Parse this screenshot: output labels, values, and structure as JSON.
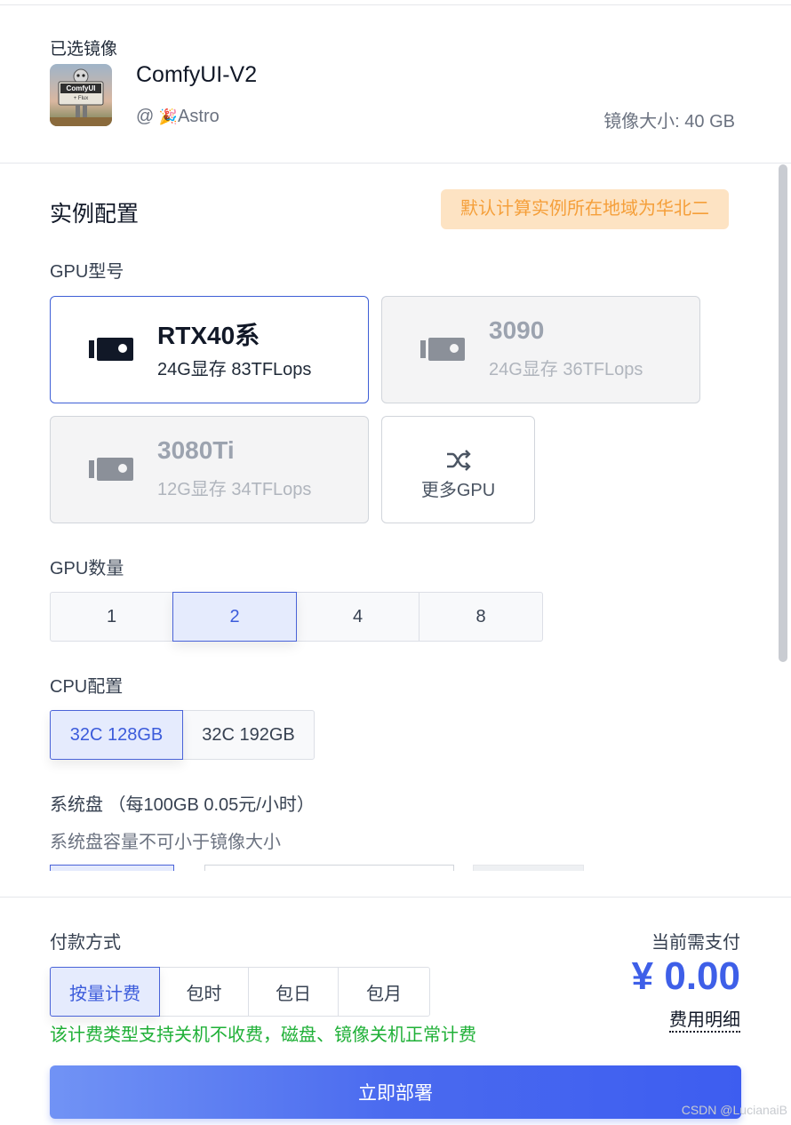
{
  "selected_image": {
    "section_label": "已选镜像",
    "name": "ComfyUI-V2",
    "author_prefix": "@",
    "author": "Astro",
    "size_text": "镜像大小: 40 GB",
    "thumb_text": "ComfyUI",
    "thumb_subtext": "+ Flux"
  },
  "config": {
    "title": "实例配置",
    "region_tip": "默认计算实例所在地域为华北二",
    "gpu_model_label": "GPU型号",
    "gpus": [
      {
        "name": "RTX40系",
        "spec": "24G显存 83TFLops",
        "selected": true
      },
      {
        "name": "3090",
        "spec": "24G显存 36TFLops",
        "selected": false
      },
      {
        "name": "3080Ti",
        "spec": "12G显存 34TFLops",
        "selected": false
      }
    ],
    "more_gpu_label": "更多GPU",
    "gpu_count_label": "GPU数量",
    "gpu_counts": [
      "1",
      "2",
      "4",
      "8"
    ],
    "gpu_count_selected": "2",
    "cpu_label": "CPU配置",
    "cpu_options": [
      "32C 128GB",
      "32C 192GB"
    ],
    "cpu_selected": "32C 128GB",
    "disk_label": "系统盘 （每100GB 0.05元/小时）",
    "disk_note": "系统盘容量不可小于镜像大小"
  },
  "payment": {
    "label": "付款方式",
    "options": [
      "按量计费",
      "包时",
      "包日",
      "包月"
    ],
    "selected": "按量计费",
    "note": "该计费类型支持关机不收费，磁盘、镜像关机正常计费",
    "due_label": "当前需支付",
    "price": "¥ 0.00",
    "fee_detail": "费用明细",
    "deploy_button": "立即部署"
  },
  "watermark": "CSDN @LucianaiB",
  "colors": {
    "accent": "#3e5fe8",
    "tip_bg": "#fde3c3",
    "tip_text": "#f59f3a",
    "note_green": "#1fb037"
  }
}
